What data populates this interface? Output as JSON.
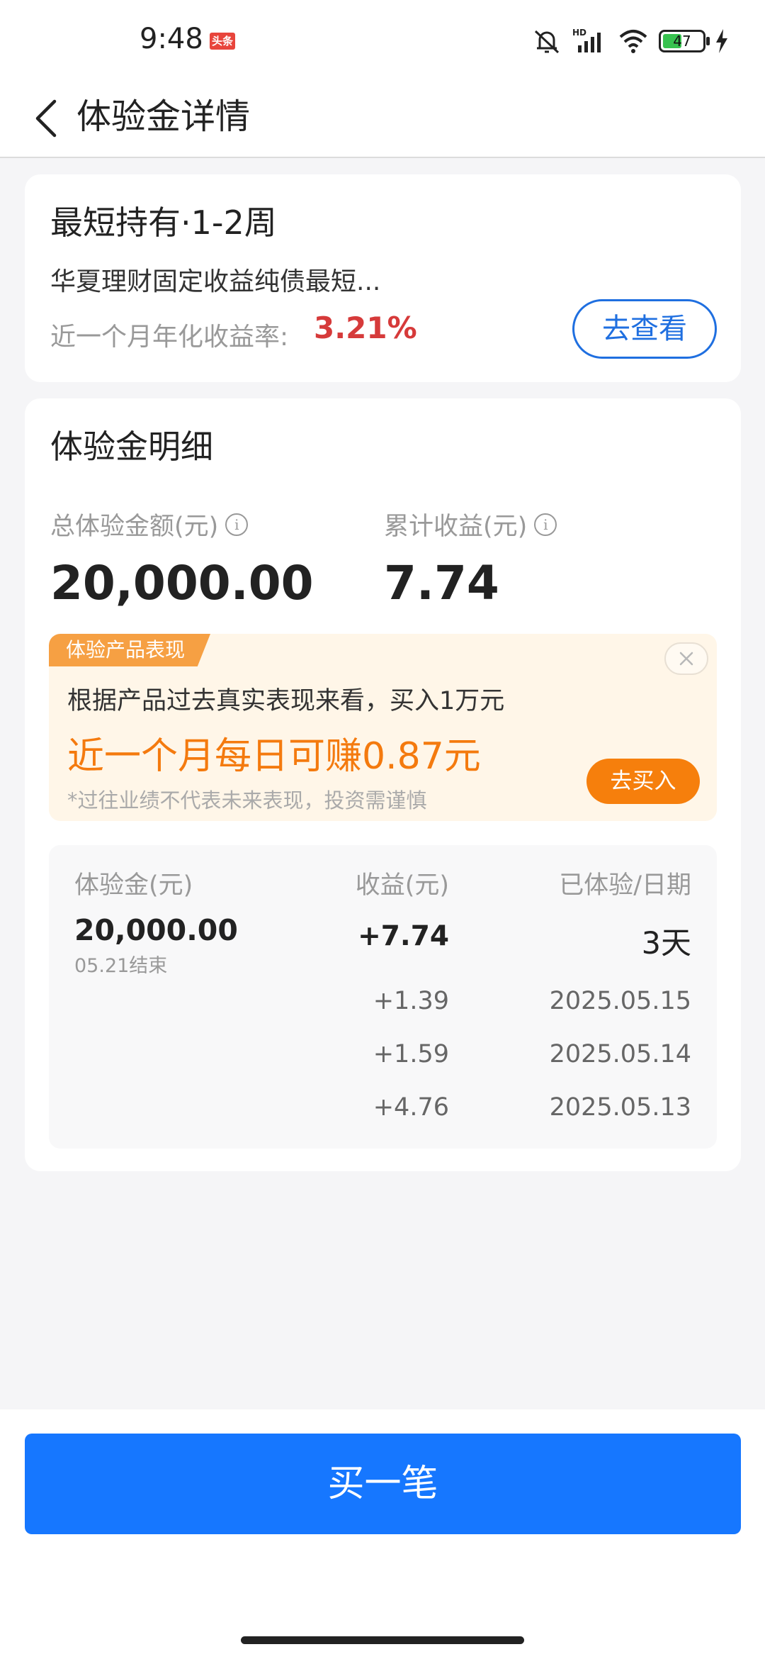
{
  "status_bar": {
    "time": "9:48",
    "badge": "头条",
    "battery": "47",
    "icons": [
      "mute-icon",
      "signal-icon",
      "wifi-icon",
      "battery-icon",
      "charging-icon"
    ]
  },
  "nav": {
    "title": "体验金详情"
  },
  "product": {
    "title": "最短持有·1-2周",
    "name": "华夏理财固定收益纯债最短...",
    "rate_label": "近一个月年化收益率:",
    "rate": "3.21%",
    "view_button": "去查看"
  },
  "detail": {
    "title": "体验金明细",
    "total_label": "总体验金额(元)",
    "total_value": "20,000.00",
    "income_label": "累计收益(元)",
    "income_value": "7.74",
    "promo": {
      "tag": "体验产品表现",
      "line1": "根据产品过去真实表现来看，买入1万元",
      "highlight": "近一个月每日可赚0.87元",
      "note": "*过往业绩不代表未来表现，投资需谨慎",
      "buy_button": "去买入"
    },
    "table": {
      "headers": [
        "体验金(元)",
        "收益(元)",
        "已体验/日期"
      ],
      "amount": "20,000.00",
      "end": "05.21结束",
      "total_income": "+7.74",
      "days": "3天",
      "rows": [
        {
          "income": "+1.39",
          "date": "2025.05.15"
        },
        {
          "income": "+1.59",
          "date": "2025.05.14"
        },
        {
          "income": "+4.76",
          "date": "2025.05.13"
        }
      ]
    }
  },
  "buy_button": "买一笔",
  "colors": {
    "accent": "#1677ff",
    "rate": "#d63a3a",
    "promo": "#f47a0e"
  }
}
